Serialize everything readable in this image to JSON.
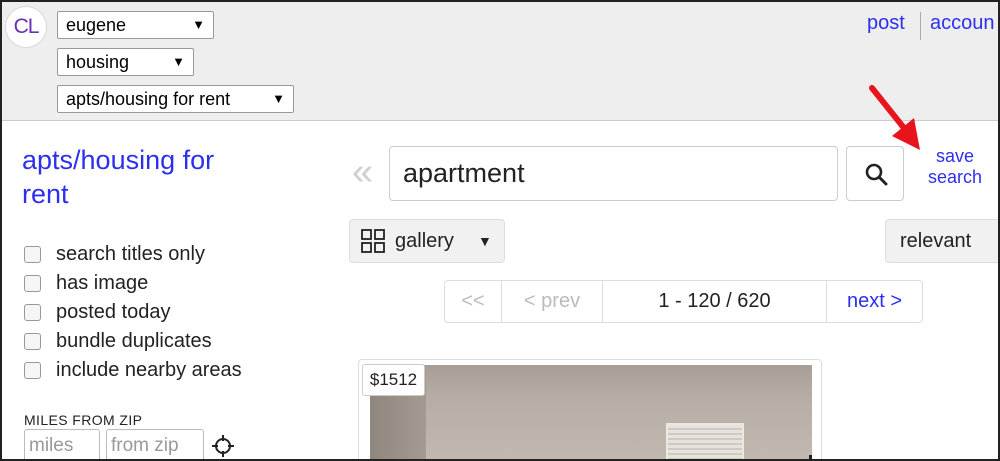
{
  "header": {
    "logo": "CL",
    "city_select": "eugene",
    "category_select": "housing",
    "subcategory_select": "apts/housing for rent",
    "post_link": "post",
    "account_link": "accoun"
  },
  "sidebar": {
    "title": "apts/housing for rent",
    "filters": [
      {
        "label": "search titles only",
        "checked": false
      },
      {
        "label": "has image",
        "checked": false
      },
      {
        "label": "posted today",
        "checked": false
      },
      {
        "label": "bundle duplicates",
        "checked": false
      },
      {
        "label": "include nearby areas",
        "checked": false
      }
    ],
    "miles_label": "MILES FROM ZIP",
    "miles_placeholder": "miles",
    "zip_placeholder": "from zip"
  },
  "search": {
    "back_glyph": "«",
    "query": "apartment",
    "save_line1": "save",
    "save_line2": "search"
  },
  "view": {
    "mode": "gallery",
    "sort": "relevant"
  },
  "pager": {
    "first": "<<",
    "prev": "< prev",
    "range": "1 - 120 / 620",
    "next": "next >"
  },
  "results": [
    {
      "price": "$1512"
    }
  ],
  "colors": {
    "link": "#2d2ff0",
    "header_bg": "#eeeeee",
    "annotation_arrow": "#e8141b"
  },
  "icons": {
    "search": "magnifier-icon",
    "gallery": "grid-icon",
    "locate": "crosshair-icon"
  }
}
